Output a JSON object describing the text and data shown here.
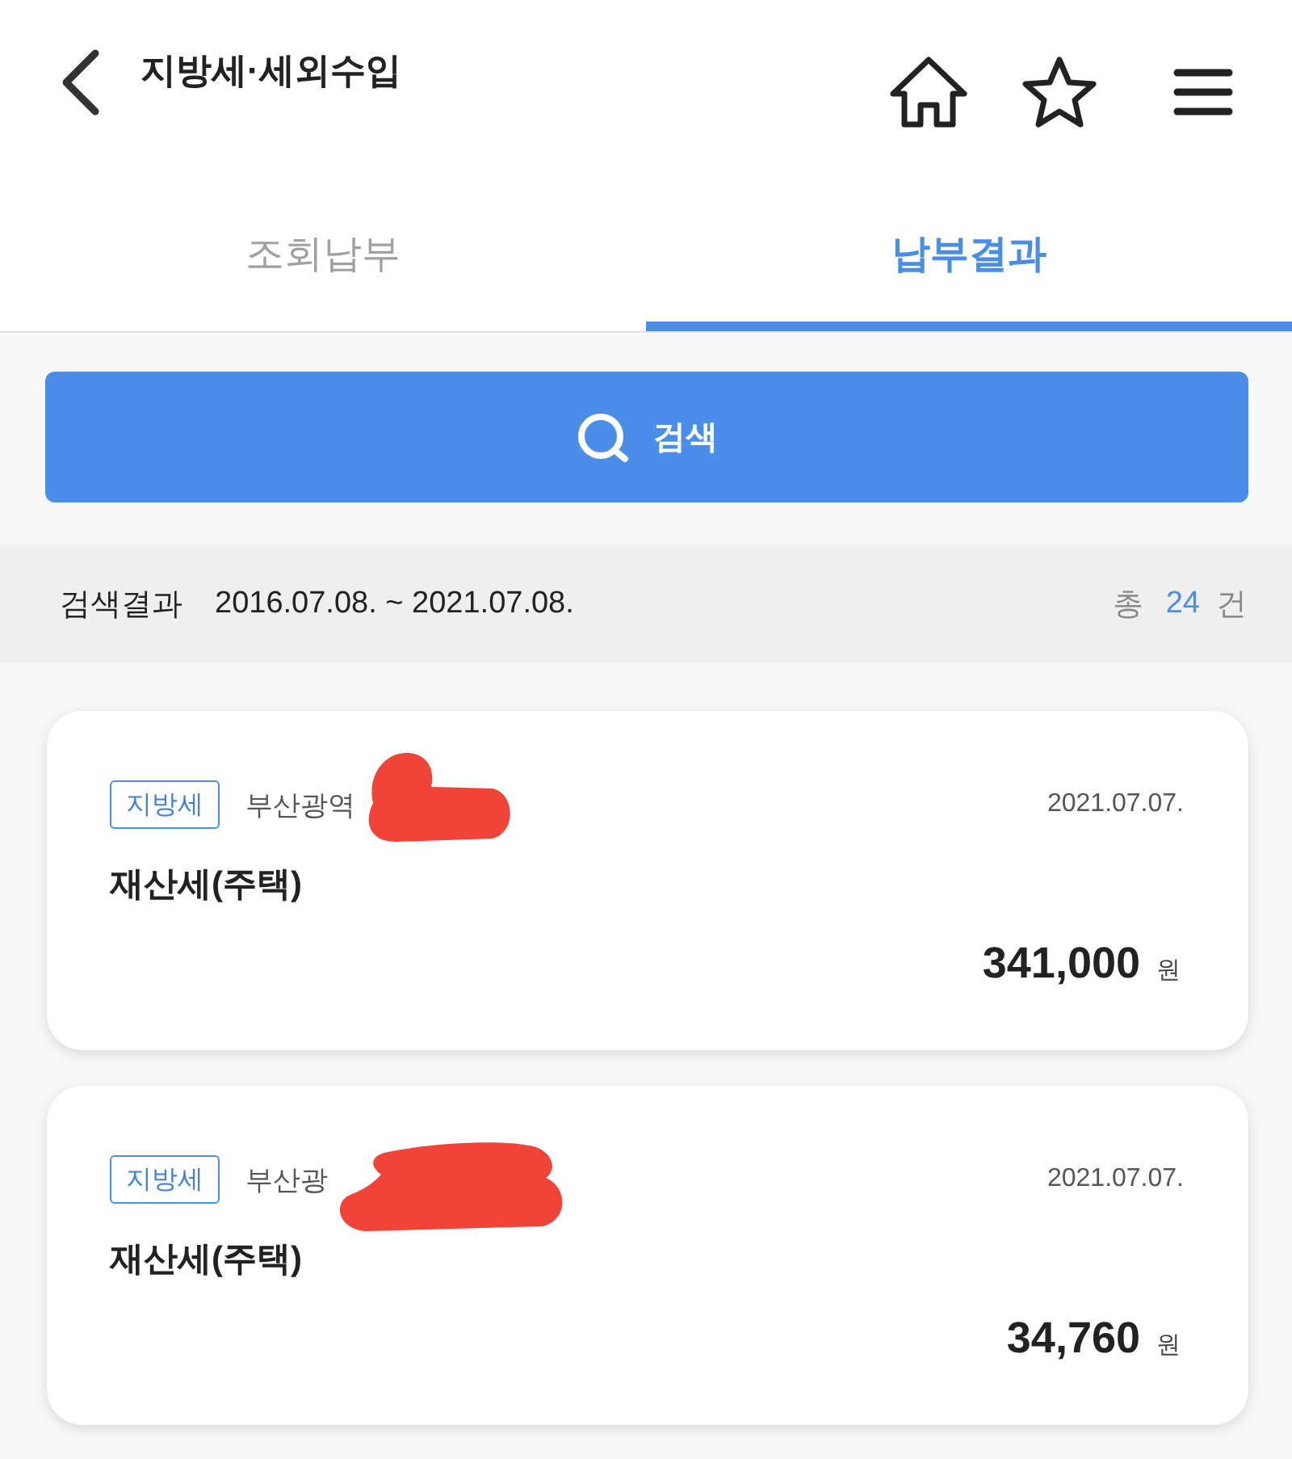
{
  "header": {
    "title": "지방세·세외수입"
  },
  "tabs": [
    {
      "label": "조회납부",
      "selected": false
    },
    {
      "label": "납부결과",
      "selected": true
    }
  ],
  "search_button": {
    "label": "검색"
  },
  "result_bar": {
    "label": "검색결과",
    "period": "2016.07.08. ~ 2021.07.08.",
    "total_prefix": "총",
    "total_count": "24",
    "total_suffix": "건"
  },
  "payments": [
    {
      "tag": "지방세",
      "region": "부산광역",
      "date": "2021.07.07.",
      "name": "재산세(주택)",
      "amount": "341,000",
      "unit": "원",
      "redacted": true
    },
    {
      "tag": "지방세",
      "region": "부산광",
      "date": "2021.07.07.",
      "name": "재산세(주택)",
      "amount": "34,760",
      "unit": "원",
      "redacted": true
    }
  ]
}
